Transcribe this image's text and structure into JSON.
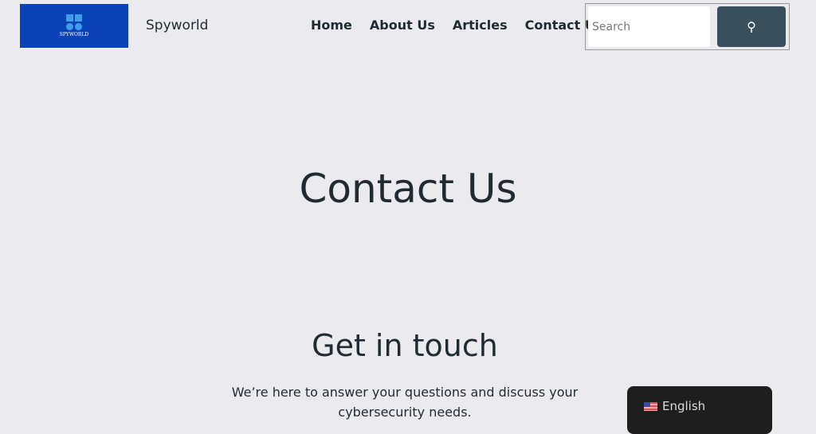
{
  "header": {
    "logo_text": "SPYWORLD",
    "site_title": "Spyworld",
    "nav": [
      "Home",
      "About Us",
      "Articles",
      "Contact Us"
    ],
    "search": {
      "placeholder": "Search",
      "button_icon": "search-icon"
    }
  },
  "main": {
    "page_title": "Contact Us",
    "section_title": "Get in touch",
    "lead": "We’re here to answer your questions and discuss your cybersecurity needs."
  },
  "language_switcher": {
    "label": "English",
    "flag": "us-flag-icon"
  },
  "colors": {
    "logo_bg": "#0a43b8",
    "search_button": "#3a4f5c",
    "background": "#ebeaef"
  }
}
